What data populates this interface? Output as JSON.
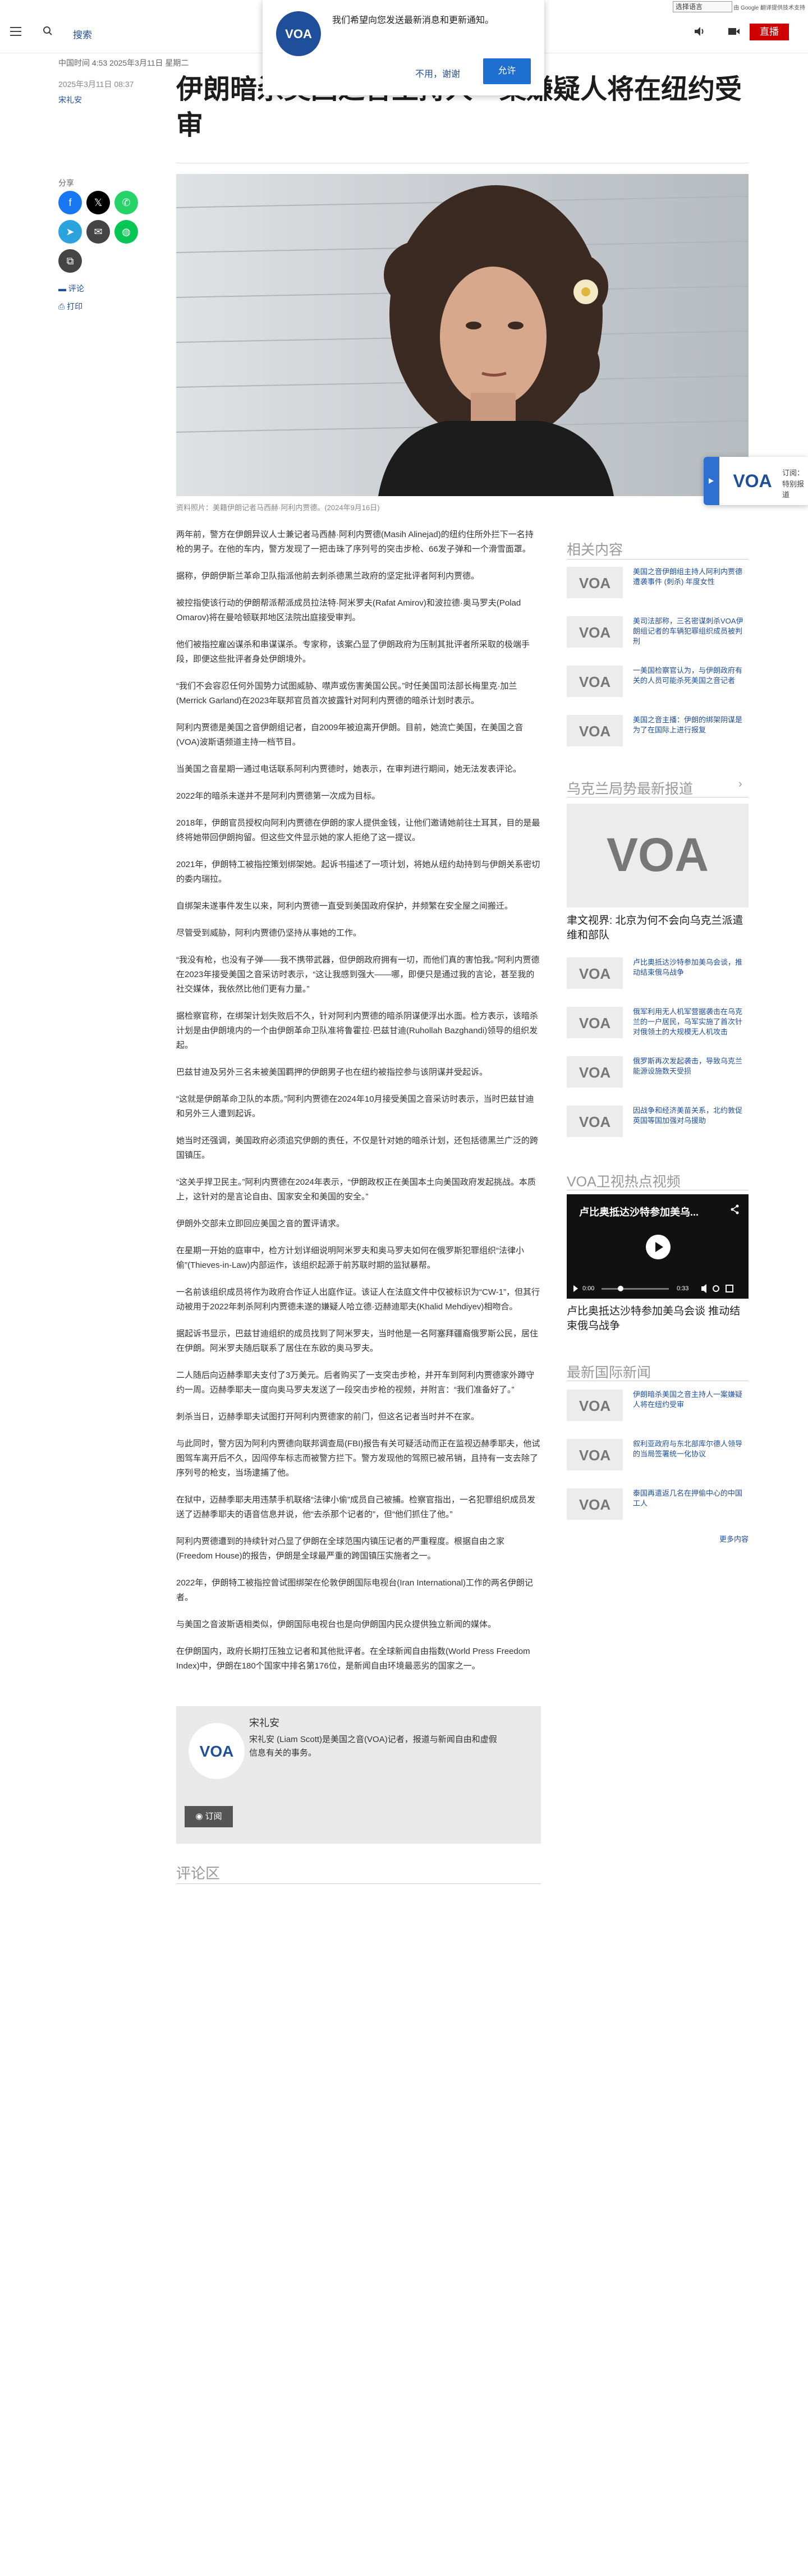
{
  "top": {
    "language_select": "选择语言",
    "translate_credit": "由 Google 翻译提供技术支持"
  },
  "header": {
    "search_label": "搜索",
    "live_label": "直播"
  },
  "notification": {
    "message": "我们希望向您发送最新消息和更新通知。",
    "decline": "不用，谢谢",
    "allow": "允许"
  },
  "article": {
    "meta_line": "中国时间 4:53 2025年3月11日 星期二",
    "date": "2025年3月11日 08:37",
    "author": "宋礼安",
    "title": "伊朗暗杀美国之音主持人一案嫌疑人将在纽约受审",
    "image_caption": "资料照片：美籍伊朗记者马西赫·阿利内贾德。(2024年9月16日)",
    "paragraphs": [
      "两年前，警方在伊朗异议人士兼记者马西赫·阿利内贾德(Masih Alinejad)的纽约住所外拦下一名持枪的男子。在他的车内，警方发现了一把击珠了序列号的突击步枪、66发子弹和一个滑雪面罩。",
      "据称，伊朗伊斯兰革命卫队指派他前去刺杀德黑兰政府的坚定批评者阿利内贾德。",
      "被控指使该行动的伊朗帮派帮派成员拉法特·阿米罗夫(Rafat Amirov)和波拉德·奥马罗夫(Polad Omarov)将在曼哈顿联邦地区法院出庭接受审判。",
      "他们被指控雇凶谋杀和串谋谋杀。专家称，该案凸显了伊朗政府为压制其批评者所采取的极端手段，即便这些批评者身处伊朗境外。",
      "“我们不会容忍任何外国势力试图威胁、噤声或伤害美国公民。”时任美国司法部长梅里克·加兰(Merrick Garland)在2023年联邦官员首次披露针对阿利内贾德的暗杀计划时表示。",
      "阿利内贾德是美国之音伊朗组记者，自2009年被迫离开伊朗。目前，她流亡美国，在美国之音(VOA)波斯语频道主持一档节目。",
      "当美国之音星期一通过电话联系阿利内贾德时，她表示，在审判进行期间，她无法发表评论。",
      "2022年的暗杀未遂并不是阿利内贾德第一次成为目标。",
      "2018年，伊朗官员授权向阿利内贾德在伊朗的家人提供金钱，让他们邀请她前往土耳其，目的是最终将她带回伊朗拘留。但这些文件显示她的家人拒绝了这一提议。",
      "2021年，伊朗特工被指控策划绑架她。起诉书描述了一项计划，将她从纽约劫持到与伊朗关系密切的委内瑞拉。",
      "自绑架未遂事件发生以来，阿利内贾德一直受到美国政府保护，并频繁在安全屋之间搬迁。",
      "尽管受到威胁，阿利内贾德仍坚持从事她的工作。",
      "“我没有枪，也没有子弹——我不携带武器，但伊朗政府拥有一切，而他们真的害怕我。”阿利内贾德在2023年接受美国之音采访时表示，“这让我感到强大——哪，即便只是通过我的言论，甚至我的社交媒体，我依然比他们更有力量。”",
      "据检察官称，在绑架计划失败后不久，针对阿利内贾德的暗杀阴谋便浮出水面。检方表示，该暗杀计划是由伊朗境内的一个由伊朗革命卫队准将鲁霍拉·巴兹甘迪(Ruhollah Bazghandi)领导的组织发起。",
      "巴兹甘迪及另外三名未被美国羁押的伊朗男子也在纽约被指控参与该阴谋并受起诉。",
      "“这就是伊朗革命卫队的本质。”阿利内贾德在2024年10月接受美国之音采访时表示，当时巴兹甘迪和另外三人遭到起诉。",
      "她当时还强调，美国政府必须追究伊朗的责任，不仅是针对她的暗杀计划，还包括德黑兰广泛的跨国镇压。",
      "“这关乎捍卫民主。”阿利内贾德在2024年表示，“伊朗政权正在美国本土向美国政府发起挑战。本质上，这针对的是言论自由、国家安全和美国的安全。”",
      "伊朗外交部未立即回应美国之音的置评请求。",
      "在星期一开始的庭审中，检方计划详细说明阿米罗夫和奥马罗夫如何在俄罗斯犯罪组织“法律小偷”(Thieves-in-Law)内部运作，该组织起源于前苏联时期的监狱暴帮。",
      "一名前该组织成员将作为政府合作证人出庭作证。该证人在法庭文件中仅被标识为“CW-1”，但其行动被用于2022年刺杀阿利内贾德未遂的嫌疑人哈立德·迈赫迪耶夫(Khalid Mehdiyev)相吻合。",
      "据起诉书显示，巴兹甘迪组织的成员找到了阿米罗夫，当时他是一名阿塞拜疆裔俄罗斯公民，居住在伊朗。阿米罗夫随后联系了居住在东欧的奥马罗夫。",
      "二人随后向迈赫季耶夫支付了3万美元。后者购买了一支突击步枪，并开车到阿利内贾德家外蹲守约一周。迈赫季耶夫一度向奥马罗夫发送了一段突击步枪的视频，并附言：“我们准备好了。”",
      "刺杀当日，迈赫季耶夫试图打开阿利内贾德家的前门，但这名记者当时并不在家。",
      "与此同时，警方因为阿利内贾德向联邦调查局(FBI)报告有关可疑活动而正在监视迈赫季耶夫，他试图驾车离开后不久，因闯停车标志而被警方拦下。警方发现他的驾照已被吊销，且持有一支去除了序列号的枪支，当场逮捕了他。",
      "在狱中，迈赫季耶夫用违禁手机联络“法律小偷”成员自己被捕。检察官指出，一名犯罪组织成员发送了迈赫季耶夫的语音信息并说，他“去杀那个记者的”，但“他们抓住了他。”",
      "阿利内贾德遭到的持续针对凸显了伊朗在全球范围内镇压记者的严重程度。根据自由之家(Freedom House)的报告，伊朗是全球最严重的跨国镇压实施者之一。",
      "2022年，伊朗特工被指控曾试图绑架在伦敦伊朗国际电视台(Iran International)工作的两名伊朗记者。",
      "与美国之音波斯语相类似，伊朗国际电视台也是向伊朗国内民众提供独立新闻的媒体。",
      "在伊朗国内，政府长期打压独立记者和其他批评者。在全球新闻自由指数(World Press Freedom Index)中，伊朗在180个国家中排名第176位，是新闻自由环境最恶劣的国家之一。"
    ],
    "share_label": "分享",
    "comment_label": "评论",
    "print_label": "打印",
    "author_box": {
      "name": "宋礼安",
      "bio": "宋礼安 (Liam Scott)是美国之音(VOA)记者，报道与新闻自由和虚假信息有关的事务。",
      "subscribe": "订阅"
    },
    "comments_title": "评论区"
  },
  "floating_card": {
    "line1": "订阅：",
    "line2": "特别报道"
  },
  "sidebar": {
    "related_title": "相关内容",
    "related": [
      "美国之音伊朗组主持人阿利内贾德遭袭事件 (刺杀) 年度女性",
      "美司法部称，三名密谋刺杀VOA伊朗组记者的车辆犯罪组织成员被判刑",
      "一美国检察官认为，与伊朗政府有关的人员可能杀死美国之音记者",
      "美国之音主播：伊朗的绑架阴谋是为了在国际上进行报复"
    ],
    "ukraine_title": "乌克兰局势最新报道",
    "ukraine_lead": "聿文视界: 北京为何不会向乌克兰派遣维和部队",
    "ukraine": [
      "卢比奥抵达沙特参加美乌会谈，推动结束俄乌战争",
      "俄军利用无人机军营据袭击在乌克兰的一户居民，乌军实施了首次针对俄领土的大规模无人机攻击",
      "俄罗斯再次发起袭击，导致乌克兰能源设施数天受损",
      "因战争和经济美苗关系，北约敦促英国等国加强对乌援助"
    ],
    "video_section_title": "VOA卫视热点视频",
    "video_overlay_title": "卢比奥抵达沙特参加美乌...",
    "video_time_current": "0:00",
    "video_time_total": "0:33",
    "video_caption": "卢比奥抵达沙特参加美乌会谈 推动结束俄乌战争",
    "intl_title": "最新国际新闻",
    "intl": [
      "伊朗暗杀美国之音主持人一案嫌疑人将在纽约受审",
      "叙利亚政府与东北部库尔德人领导的当局签署统一化协议",
      "泰国再遣返几名在押偷中心的中国工人"
    ],
    "more_label": "更多内容"
  }
}
